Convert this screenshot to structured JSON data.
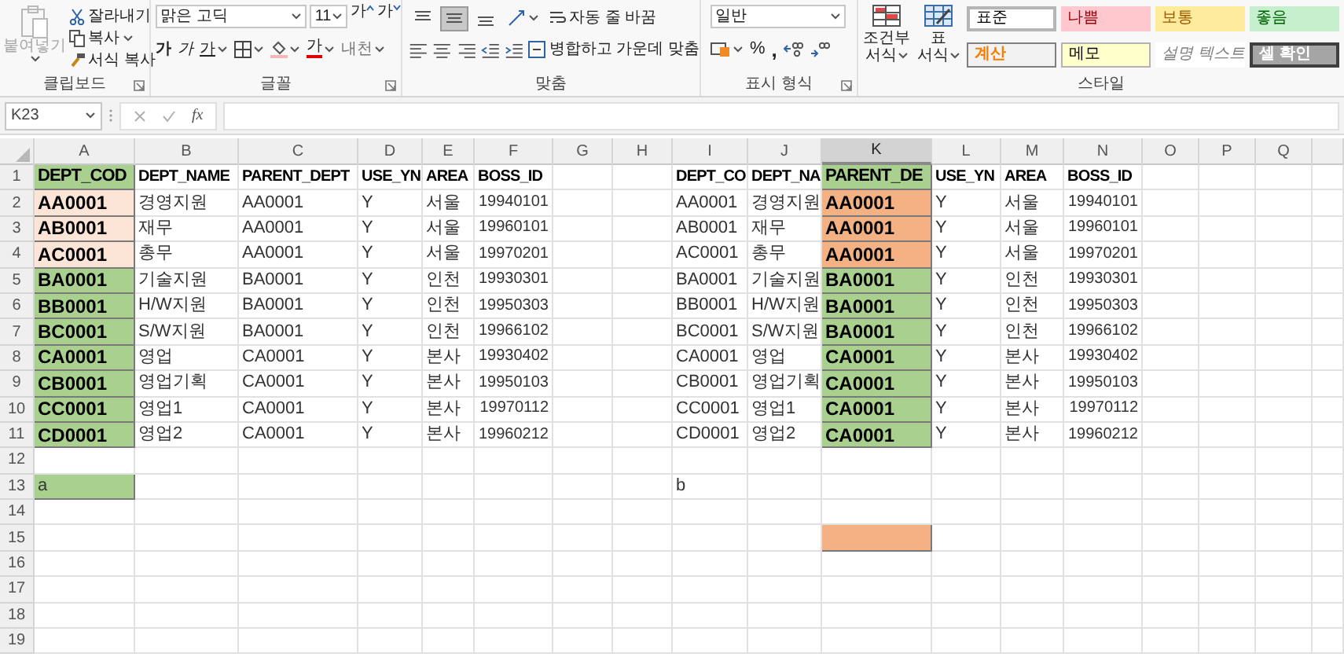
{
  "ribbon": {
    "clipboard": {
      "label": "클립보드",
      "paste": {
        "label": "붙여넣기",
        "disabled": true
      },
      "cut": "잘라내기",
      "copy": "복사",
      "format_painter": "서식 복사"
    },
    "font": {
      "label": "글꼴",
      "font_name": "맑은 고딕",
      "font_size": "11",
      "grow": "가",
      "shrink": "가",
      "bold": "가",
      "italic": "가",
      "underline": "가",
      "font_color": "가",
      "phonetic": "내천"
    },
    "alignment": {
      "label": "맞춤",
      "wrap_text": "자동 줄 바꿈",
      "merge_center": "병합하고 가운데 맞춤",
      "vertical": [
        {
          "kind": "top",
          "selected": false
        },
        {
          "kind": "middle",
          "selected": true
        },
        {
          "kind": "bottom",
          "selected": false
        }
      ]
    },
    "number": {
      "label": "표시 형식",
      "format": "일반",
      "percent": "%",
      "comma": ","
    },
    "styles": {
      "label": "스타일",
      "conditional": [
        "조건부",
        "서식"
      ],
      "table": [
        "표",
        "서식"
      ],
      "gallery": [
        {
          "text": "표준",
          "kind": "normal"
        },
        {
          "text": "나쁨",
          "kind": "bad"
        },
        {
          "text": "보통",
          "kind": "neutral"
        },
        {
          "text": "좋음",
          "kind": "good"
        },
        {
          "text": "계산",
          "kind": "calculation"
        },
        {
          "text": "메모",
          "kind": "note"
        },
        {
          "text": "설명 텍스트",
          "kind": "explanatory"
        },
        {
          "text": "셀 확인",
          "kind": "check"
        }
      ]
    }
  },
  "formula_bar": {
    "name_box": "K23",
    "fx": "fx"
  },
  "sheet": {
    "columns": [
      {
        "label": "A",
        "selected": false
      },
      {
        "label": "B",
        "selected": false
      },
      {
        "label": "C",
        "selected": false
      },
      {
        "label": "D",
        "selected": false
      },
      {
        "label": "E",
        "selected": false
      },
      {
        "label": "F",
        "selected": false
      },
      {
        "label": "G",
        "selected": false
      },
      {
        "label": "H",
        "selected": false
      },
      {
        "label": "I",
        "selected": false
      },
      {
        "label": "J",
        "selected": false
      },
      {
        "label": "K",
        "selected": true
      },
      {
        "label": "L",
        "selected": false
      },
      {
        "label": "M",
        "selected": false
      },
      {
        "label": "N",
        "selected": false
      },
      {
        "label": "O",
        "selected": false
      },
      {
        "label": "P",
        "selected": false
      },
      {
        "label": "Q",
        "selected": false
      }
    ],
    "rows": [
      {
        "label": "1",
        "cells": [
          {
            "text": "DEPT_COD",
            "kind": "code_heading",
            "color": "#a9d08e"
          },
          {
            "text": "DEPT_NAME",
            "kind": "heading"
          },
          {
            "text": "PARENT_DEPT",
            "kind": "heading"
          },
          {
            "text": "USE_YN",
            "kind": "heading"
          },
          {
            "text": "AREA",
            "kind": "heading"
          },
          {
            "text": "BOSS_ID",
            "kind": "heading"
          },
          null,
          null,
          {
            "text": "DEPT_CO",
            "kind": "heading"
          },
          {
            "text": "DEPT_NA",
            "kind": "heading"
          },
          {
            "text": "PARENT_DE",
            "kind": "code_heading",
            "color": "#a9d08e"
          },
          {
            "text": "USE_YN",
            "kind": "heading"
          },
          {
            "text": "AREA",
            "kind": "heading"
          },
          {
            "text": "BOSS_ID",
            "kind": "heading"
          }
        ]
      },
      {
        "label": "2",
        "cells": [
          {
            "text": "AA0001",
            "kind": "code",
            "color": "#fce4d6"
          },
          {
            "text": "경영지원",
            "kind": "text"
          },
          {
            "text": "AA0001",
            "kind": "text"
          },
          {
            "text": "Y",
            "kind": "text"
          },
          {
            "text": "서울",
            "kind": "text"
          },
          {
            "text": "19940101",
            "kind": "number"
          },
          null,
          null,
          {
            "text": "AA0001",
            "kind": "text"
          },
          {
            "text": "경영지원",
            "kind": "text"
          },
          {
            "text": "AA0001",
            "kind": "code",
            "color": "#f4b183"
          },
          {
            "text": "Y",
            "kind": "text"
          },
          {
            "text": "서울",
            "kind": "text"
          },
          {
            "text": "19940101",
            "kind": "number"
          }
        ]
      },
      {
        "label": "3",
        "cells": [
          {
            "text": "AB0001",
            "kind": "code",
            "color": "#fce4d6"
          },
          {
            "text": "재무",
            "kind": "text"
          },
          {
            "text": "AA0001",
            "kind": "text"
          },
          {
            "text": "Y",
            "kind": "text"
          },
          {
            "text": "서울",
            "kind": "text"
          },
          {
            "text": "19960101",
            "kind": "number"
          },
          null,
          null,
          {
            "text": "AB0001",
            "kind": "text"
          },
          {
            "text": "재무",
            "kind": "text"
          },
          {
            "text": "AA0001",
            "kind": "code",
            "color": "#f4b183"
          },
          {
            "text": "Y",
            "kind": "text"
          },
          {
            "text": "서울",
            "kind": "text"
          },
          {
            "text": "19960101",
            "kind": "number"
          }
        ]
      },
      {
        "label": "4",
        "cells": [
          {
            "text": "AC0001",
            "kind": "code",
            "color": "#fce4d6"
          },
          {
            "text": "총무",
            "kind": "text"
          },
          {
            "text": "AA0001",
            "kind": "text"
          },
          {
            "text": "Y",
            "kind": "text"
          },
          {
            "text": "서울",
            "kind": "text"
          },
          {
            "text": "19970201",
            "kind": "number"
          },
          null,
          null,
          {
            "text": "AC0001",
            "kind": "text"
          },
          {
            "text": "총무",
            "kind": "text"
          },
          {
            "text": "AA0001",
            "kind": "code",
            "color": "#f4b183"
          },
          {
            "text": "Y",
            "kind": "text"
          },
          {
            "text": "서울",
            "kind": "text"
          },
          {
            "text": "19970201",
            "kind": "number"
          }
        ]
      },
      {
        "label": "5",
        "cells": [
          {
            "text": "BA0001",
            "kind": "code",
            "color": "#a9d08e"
          },
          {
            "text": "기술지원",
            "kind": "text"
          },
          {
            "text": "BA0001",
            "kind": "text"
          },
          {
            "text": "Y",
            "kind": "text"
          },
          {
            "text": "인천",
            "kind": "text"
          },
          {
            "text": "19930301",
            "kind": "number"
          },
          null,
          null,
          {
            "text": "BA0001",
            "kind": "text"
          },
          {
            "text": "기술지원",
            "kind": "text"
          },
          {
            "text": "BA0001",
            "kind": "code",
            "color": "#a9d08e"
          },
          {
            "text": "Y",
            "kind": "text"
          },
          {
            "text": "인천",
            "kind": "text"
          },
          {
            "text": "19930301",
            "kind": "number"
          }
        ]
      },
      {
        "label": "6",
        "cells": [
          {
            "text": "BB0001",
            "kind": "code",
            "color": "#a9d08e"
          },
          {
            "text": "H/W지원",
            "kind": "text"
          },
          {
            "text": "BA0001",
            "kind": "text"
          },
          {
            "text": "Y",
            "kind": "text"
          },
          {
            "text": "인천",
            "kind": "text"
          },
          {
            "text": "19950303",
            "kind": "number"
          },
          null,
          null,
          {
            "text": "BB0001",
            "kind": "text"
          },
          {
            "text": "H/W지원",
            "kind": "text"
          },
          {
            "text": "BA0001",
            "kind": "code",
            "color": "#a9d08e"
          },
          {
            "text": "Y",
            "kind": "text"
          },
          {
            "text": "인천",
            "kind": "text"
          },
          {
            "text": "19950303",
            "kind": "number"
          }
        ]
      },
      {
        "label": "7",
        "cells": [
          {
            "text": "BC0001",
            "kind": "code",
            "color": "#a9d08e"
          },
          {
            "text": "S/W지원",
            "kind": "text"
          },
          {
            "text": "BA0001",
            "kind": "text"
          },
          {
            "text": "Y",
            "kind": "text"
          },
          {
            "text": "인천",
            "kind": "text"
          },
          {
            "text": "19966102",
            "kind": "number"
          },
          null,
          null,
          {
            "text": "BC0001",
            "kind": "text"
          },
          {
            "text": "S/W지원",
            "kind": "text"
          },
          {
            "text": "BA0001",
            "kind": "code",
            "color": "#a9d08e"
          },
          {
            "text": "Y",
            "kind": "text"
          },
          {
            "text": "인천",
            "kind": "text"
          },
          {
            "text": "19966102",
            "kind": "number"
          }
        ]
      },
      {
        "label": "8",
        "cells": [
          {
            "text": "CA0001",
            "kind": "code",
            "color": "#a9d08e"
          },
          {
            "text": "영업",
            "kind": "text"
          },
          {
            "text": "CA0001",
            "kind": "text"
          },
          {
            "text": "Y",
            "kind": "text"
          },
          {
            "text": "본사",
            "kind": "text"
          },
          {
            "text": "19930402",
            "kind": "number"
          },
          null,
          null,
          {
            "text": "CA0001",
            "kind": "text"
          },
          {
            "text": "영업",
            "kind": "text"
          },
          {
            "text": "CA0001",
            "kind": "code",
            "color": "#a9d08e"
          },
          {
            "text": "Y",
            "kind": "text"
          },
          {
            "text": "본사",
            "kind": "text"
          },
          {
            "text": "19930402",
            "kind": "number"
          }
        ]
      },
      {
        "label": "9",
        "cells": [
          {
            "text": "CB0001",
            "kind": "code",
            "color": "#a9d08e"
          },
          {
            "text": "영업기획",
            "kind": "text"
          },
          {
            "text": "CA0001",
            "kind": "text"
          },
          {
            "text": "Y",
            "kind": "text"
          },
          {
            "text": "본사",
            "kind": "text"
          },
          {
            "text": "19950103",
            "kind": "number"
          },
          null,
          null,
          {
            "text": "CB0001",
            "kind": "text"
          },
          {
            "text": "영업기획",
            "kind": "text"
          },
          {
            "text": "CA0001",
            "kind": "code",
            "color": "#a9d08e"
          },
          {
            "text": "Y",
            "kind": "text"
          },
          {
            "text": "본사",
            "kind": "text"
          },
          {
            "text": "19950103",
            "kind": "number"
          }
        ]
      },
      {
        "label": "10",
        "cells": [
          {
            "text": "CC0001",
            "kind": "code",
            "color": "#a9d08e"
          },
          {
            "text": "영업1",
            "kind": "text"
          },
          {
            "text": "CA0001",
            "kind": "text"
          },
          {
            "text": "Y",
            "kind": "text"
          },
          {
            "text": "본사",
            "kind": "text"
          },
          {
            "text": "19970112",
            "kind": "number"
          },
          null,
          null,
          {
            "text": "CC0001",
            "kind": "text"
          },
          {
            "text": "영업1",
            "kind": "text"
          },
          {
            "text": "CA0001",
            "kind": "code",
            "color": "#a9d08e"
          },
          {
            "text": "Y",
            "kind": "text"
          },
          {
            "text": "본사",
            "kind": "text"
          },
          {
            "text": "19970112",
            "kind": "number"
          }
        ]
      },
      {
        "label": "11",
        "cells": [
          {
            "text": "CD0001",
            "kind": "code",
            "color": "#a9d08e"
          },
          {
            "text": "영업2",
            "kind": "text"
          },
          {
            "text": "CA0001",
            "kind": "text"
          },
          {
            "text": "Y",
            "kind": "text"
          },
          {
            "text": "본사",
            "kind": "text"
          },
          {
            "text": "19960212",
            "kind": "number"
          },
          null,
          null,
          {
            "text": "CD0001",
            "kind": "text"
          },
          {
            "text": "영업2",
            "kind": "text"
          },
          {
            "text": "CA0001",
            "kind": "code",
            "color": "#a9d08e"
          },
          {
            "text": "Y",
            "kind": "text"
          },
          {
            "text": "본사",
            "kind": "text"
          },
          {
            "text": "19960212",
            "kind": "number"
          }
        ]
      },
      {
        "label": "12"
      },
      {
        "label": "13",
        "cells": [
          {
            "text": "a",
            "kind": "text",
            "color": "#a9d08e"
          },
          null,
          null,
          null,
          null,
          null,
          null,
          null,
          {
            "text": "b",
            "kind": "text"
          }
        ]
      },
      {
        "label": "14"
      },
      {
        "label": "15",
        "cells": [
          null,
          null,
          null,
          null,
          null,
          null,
          null,
          null,
          null,
          null,
          {
            "color": "#f4b183"
          }
        ]
      },
      {
        "label": "16"
      },
      {
        "label": "17"
      },
      {
        "label": "18"
      },
      {
        "label": "19"
      }
    ]
  }
}
